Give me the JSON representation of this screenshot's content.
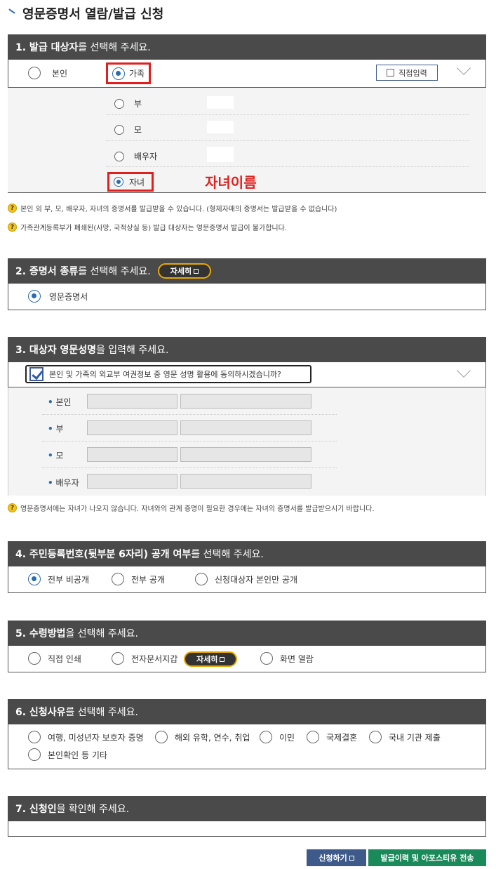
{
  "page_title": "영문증명서 열람/발급 신청",
  "section1": {
    "title_bold": "1. 발급 대상자",
    "title_rest": "를 선택해 주세요.",
    "options": {
      "self": "본인",
      "family": "가족"
    },
    "manual_input": "직접입력",
    "family_members": [
      "부",
      "모",
      "배우자",
      "자녀"
    ],
    "child_name_label": "자녀이름",
    "notes": [
      "본인 외 부, 모, 배우자, 자녀의 증명서를 발급받을 수 있습니다. (형제자매의 증명서는 발급받을 수 없습니다)",
      "가족관계등록부가 폐쇄된(사망, 국적상실 등) 발급 대상자는 영문증명서 발급이 불가합니다."
    ]
  },
  "section2": {
    "title_bold": "2. 증명서 종류",
    "title_rest": "를 선택해 주세요.",
    "detail_button": "자세히",
    "option": "영문증명서"
  },
  "section3": {
    "title_bold": "3. 대상자 영문성명",
    "title_rest": "을 입력해 주세요.",
    "consent_text": "본인 및 가족의 외교부 여권정보 중 영문 성명 활용에 동의하시겠습니까?",
    "rows": [
      "본인",
      "부",
      "모",
      "배우자"
    ],
    "note": "영문증명서에는 자녀가 나오지 않습니다. 자녀와의 관계 증명이 필요한 경우에는 자녀의 증명서를 발급받으시기 바랍니다."
  },
  "section4": {
    "title_bold": "4. 주민등록번호(뒷부분 6자리) 공개 여부",
    "title_rest": "를 선택해 주세요.",
    "options": [
      "전부 비공개",
      "전부 공개",
      "신청대상자 본인만 공개"
    ]
  },
  "section5": {
    "title_bold": "5. 수령방법",
    "title_rest": "을 선택해 주세요.",
    "options": [
      "직접 인쇄",
      "전자문서지갑",
      "화면 열람"
    ],
    "detail_button": "자세히"
  },
  "section6": {
    "title_bold": "6. 신청사유",
    "title_rest": "를 선택해 주세요.",
    "options": [
      "여행, 미성년자 보호자 증명",
      "해외 유학, 연수, 취업",
      "이민",
      "국제결혼",
      "국내 기관 제출",
      "본인확인 등 기타"
    ]
  },
  "section7": {
    "title_bold": "7. 신청인",
    "title_rest": "을 확인해 주세요."
  },
  "buttons": {
    "apply": "신청하기",
    "history": "발급이력 및 아포스티유 전송"
  },
  "colors": {
    "header_bg": "#4a4a4a",
    "accent_blue": "#2b6cb0",
    "highlight_red": "#e0201e",
    "apply_btn": "#3d5a8a",
    "history_btn": "#1a8a5a"
  }
}
